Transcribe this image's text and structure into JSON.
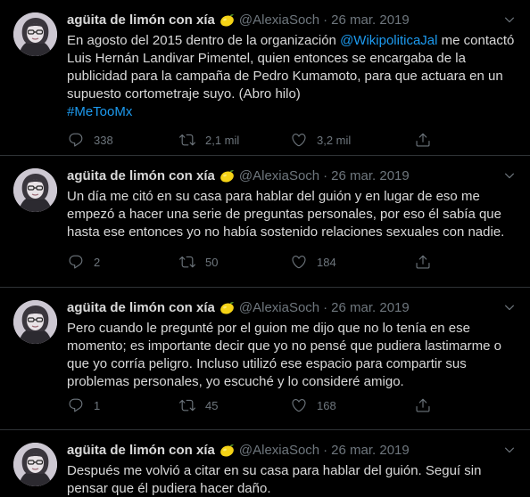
{
  "tweets": [
    {
      "name": "agüita de limón con xía",
      "handle": "@AlexiaSoch",
      "date": "26 mar. 2019",
      "text_before": "En agosto del 2015 dentro de la organización ",
      "mention": "@WikipoliticaJal",
      "text_after": " me contactó Luis Hernán Landivar Pimentel, quien entonces se encargaba de la publicidad para la campaña de Pedro Kumamoto, para que actuara en un supuesto cortometraje suyo. (Abro hilo)",
      "hashtag": "#MeTooMx",
      "replies": "338",
      "retweets": "2,1 mil",
      "likes": "3,2 mil"
    },
    {
      "name": "agüita de limón con xía",
      "handle": "@AlexiaSoch",
      "date": "26 mar. 2019",
      "text": "Un día me citó en su casa para hablar del guión y en lugar de eso me empezó a hacer una serie de preguntas personales, por eso él sabía que hasta ese entonces yo no había sostenido relaciones sexuales con nadie.",
      "replies": "2",
      "retweets": "50",
      "likes": "184"
    },
    {
      "name": "agüita de limón con xía",
      "handle": "@AlexiaSoch",
      "date": "26 mar. 2019",
      "text": "Pero cuando le pregunté por el guion me dijo que no lo tenía en ese momento; es importante decir que yo no pensé que pudiera lastimarme o que yo corría peligro. Incluso utilizó ese espacio para compartir sus problemas personales, yo escuché y lo consideré amigo.",
      "replies": "1",
      "retweets": "45",
      "likes": "168"
    },
    {
      "name": "agüita de limón con xía",
      "handle": "@AlexiaSoch",
      "date": "26 mar. 2019",
      "text": "Después me volvió a citar en su casa para hablar del guión. Seguí sin pensar que él pudiera hacer daño."
    }
  ],
  "colors": {
    "background": "#000000",
    "text": "#d9d9d9",
    "muted": "#6e767d",
    "link": "#1d9bf0",
    "divider": "#2f3336"
  },
  "icons": {
    "reply": "reply-icon",
    "retweet": "retweet-icon",
    "like": "heart-icon",
    "share": "share-icon",
    "more": "chevron-down-icon",
    "emoji": "lemon-emoji"
  }
}
